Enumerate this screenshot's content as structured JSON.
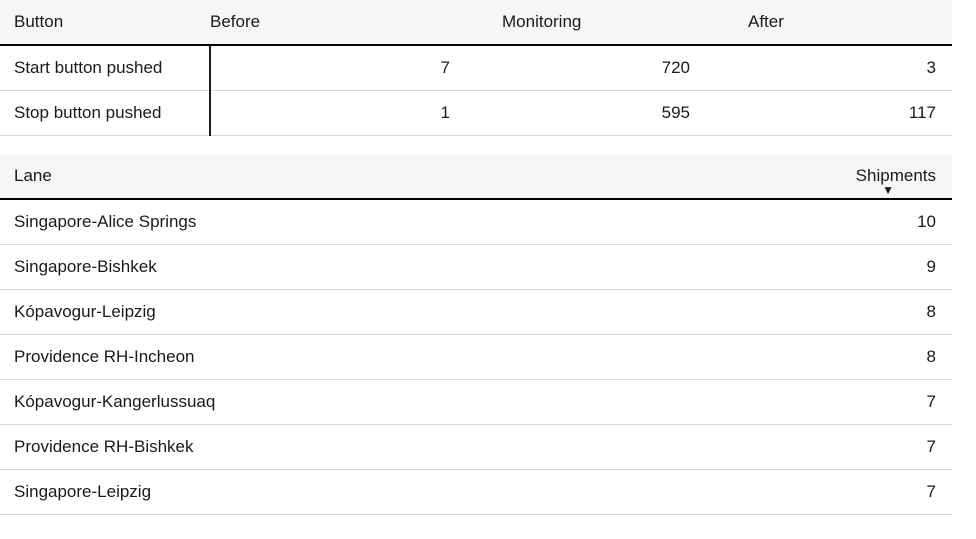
{
  "table1": {
    "headers": [
      "Button",
      "Before",
      "Monitoring",
      "After"
    ],
    "rows": [
      {
        "button": "Start button pushed",
        "before": "7",
        "monitoring": "720",
        "after": "3"
      },
      {
        "button": "Stop button pushed",
        "before": "1",
        "monitoring": "595",
        "after": "117"
      }
    ]
  },
  "table2": {
    "headers": [
      "Lane",
      "Shipments"
    ],
    "sort_caret": "▼",
    "rows": [
      {
        "lane": "Singapore-Alice Springs",
        "shipments": "10"
      },
      {
        "lane": "Singapore-Bishkek",
        "shipments": "9"
      },
      {
        "lane": "Kópavogur-Leipzig",
        "shipments": "8"
      },
      {
        "lane": "Providence RH-Incheon",
        "shipments": "8"
      },
      {
        "lane": "Kópavogur-Kangerlussuaq",
        "shipments": "7"
      },
      {
        "lane": "Providence RH-Bishkek",
        "shipments": "7"
      },
      {
        "lane": "Singapore-Leipzig",
        "shipments": "7"
      }
    ]
  }
}
